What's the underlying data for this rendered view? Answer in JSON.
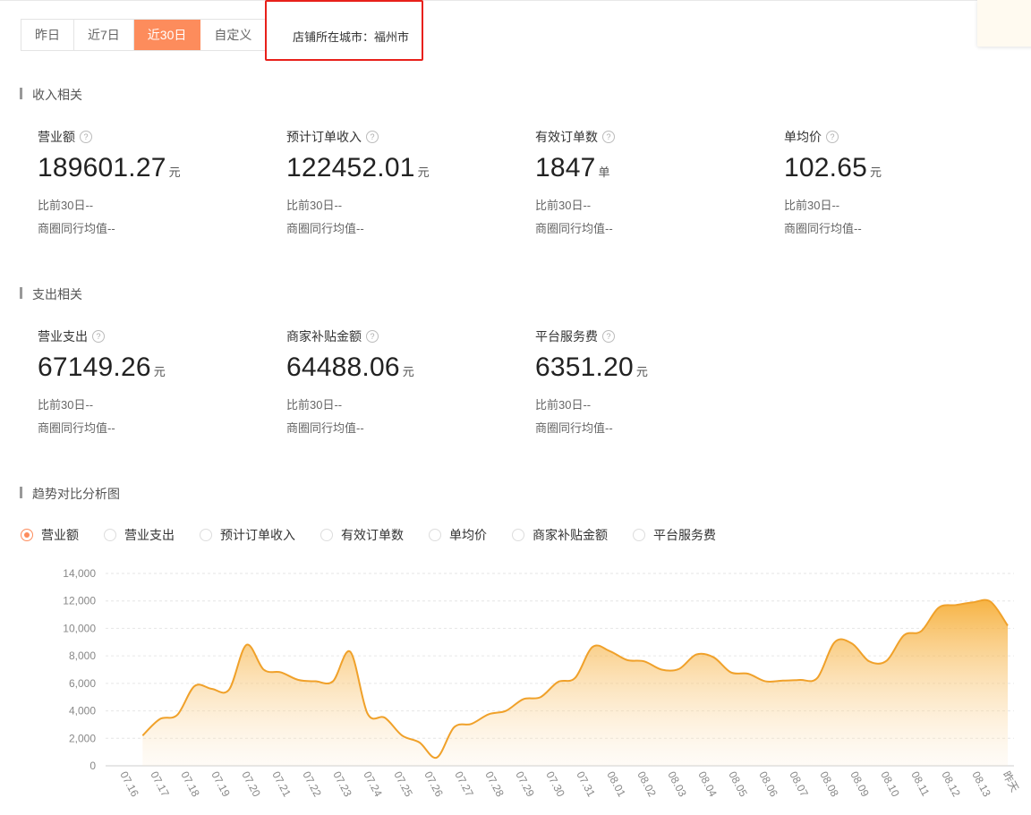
{
  "date_range": {
    "tabs": [
      "昨日",
      "近7日",
      "近30日",
      "自定义"
    ],
    "active_index": 2
  },
  "city": {
    "label": "店铺所在城市：福州市"
  },
  "colors": {
    "accent": "#fd8c5c",
    "line": "#f0a12a",
    "highlight_box": "#e8201a"
  },
  "sections": [
    {
      "title": "收入相关",
      "metrics": [
        {
          "label": "营业额",
          "value": "189601.27",
          "unit": "元",
          "compare": "比前30日--",
          "avg": "商圈同行均值--"
        },
        {
          "label": "预计订单收入",
          "value": "122452.01",
          "unit": "元",
          "compare": "比前30日--",
          "avg": "商圈同行均值--"
        },
        {
          "label": "有效订单数",
          "value": "1847",
          "unit": "单",
          "compare": "比前30日--",
          "avg": "商圈同行均值--"
        },
        {
          "label": "单均价",
          "value": "102.65",
          "unit": "元",
          "compare": "比前30日--",
          "avg": "商圈同行均值--"
        }
      ]
    },
    {
      "title": "支出相关",
      "metrics": [
        {
          "label": "营业支出",
          "value": "67149.26",
          "unit": "元",
          "compare": "比前30日--",
          "avg": "商圈同行均值--"
        },
        {
          "label": "商家补贴金额",
          "value": "64488.06",
          "unit": "元",
          "compare": "比前30日--",
          "avg": "商圈同行均值--"
        },
        {
          "label": "平台服务费",
          "value": "6351.20",
          "unit": "元",
          "compare": "比前30日--",
          "avg": "商圈同行均值--"
        }
      ]
    },
    {
      "title": "趋势对比分析图",
      "metrics": []
    }
  ],
  "trend": {
    "options": [
      "营业额",
      "营业支出",
      "预计订单收入",
      "有效订单数",
      "单均价",
      "商家补贴金额",
      "平台服务费"
    ],
    "selected_index": 0
  },
  "chart_data": {
    "type": "area",
    "x": [
      "07.16",
      "07.17",
      "07.18",
      "07.19",
      "07.20",
      "07.21",
      "07.22",
      "07.23",
      "07.24",
      "07.25",
      "07.26",
      "07.27",
      "07.28",
      "07.29",
      "07.30",
      "07.31",
      "08.01",
      "08.02",
      "08.03",
      "08.04",
      "08.05",
      "08.06",
      "08.07",
      "08.08",
      "08.09",
      "08.10",
      "08.11",
      "08.12",
      "08.13",
      "昨天"
    ],
    "series": [
      {
        "values": [
          null,
          2200,
          3400,
          3700,
          5800,
          5600,
          5550,
          8800,
          7000,
          6800,
          6250,
          6150,
          6150,
          8300,
          3800,
          3500,
          2200,
          1700,
          600,
          2800,
          3050,
          3750,
          4000,
          4850,
          5000,
          6100,
          6400,
          8650,
          8350,
          7700,
          7600,
          7000,
          7050,
          8100,
          7900,
          6800,
          6700,
          6150,
          6200,
          6250,
          6400,
          9000,
          8900,
          7600,
          7650,
          9500,
          9800,
          11500,
          11700,
          11900,
          11950,
          10200
        ]
      }
    ],
    "ylim": [
      0,
      14000
    ],
    "yticks": [
      "0",
      "2,000",
      "4,000",
      "6,000",
      "8,000",
      "10,000",
      "12,000",
      "14,000"
    ],
    "grid": true
  }
}
